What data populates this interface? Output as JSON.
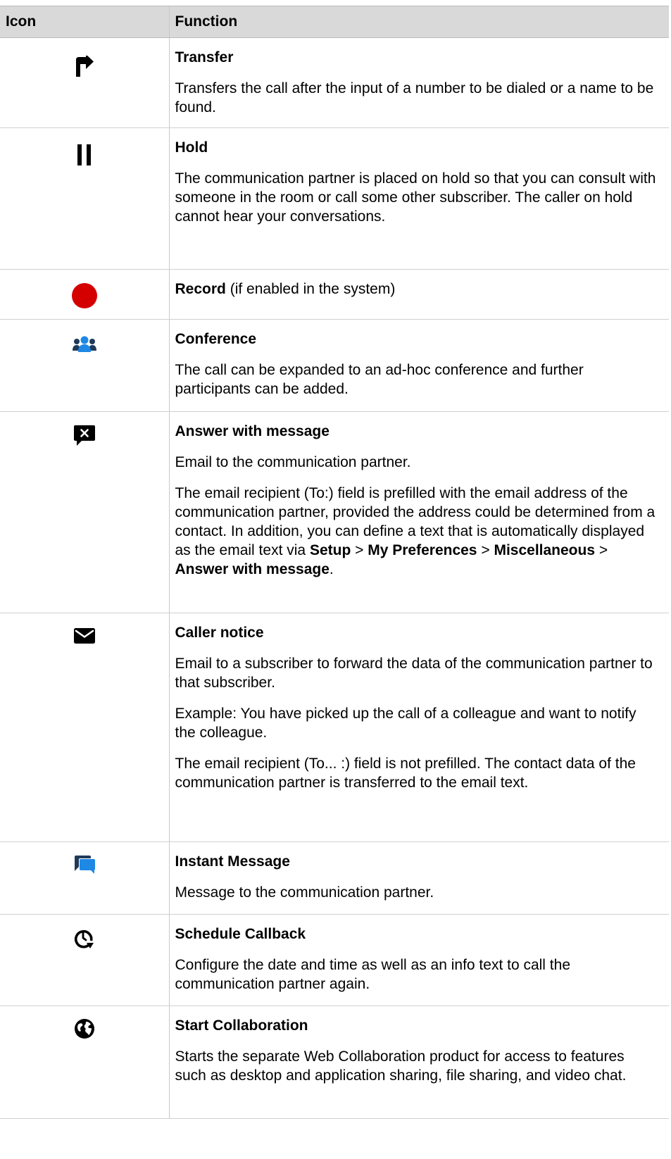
{
  "header": {
    "icon": "Icon",
    "function": "Function"
  },
  "rows": [
    {
      "icon": "transfer-arrow-icon",
      "title": "Transfer",
      "paragraphs": [
        "Transfers the call after the input of a number to be dialed or a name to be found."
      ]
    },
    {
      "icon": "pause-icon",
      "title": "Hold",
      "paragraphs": [
        "The communication partner is placed on hold so that you can consult with someone in the room or call some other subscriber. The caller on hold cannot hear your conversations."
      ]
    },
    {
      "icon": "record-dot-icon",
      "title": "Record",
      "title_note": "(if enabled in the system)",
      "paragraphs": []
    },
    {
      "icon": "conference-people-icon",
      "title": "Conference",
      "paragraphs": [
        "The call can be expanded to an ad-hoc conference and further participants can be added."
      ]
    },
    {
      "icon": "message-reject-icon",
      "title": "Answer with message",
      "paragraphs": [
        "Email to the communication partner.",
        "The email recipient (To:) field is prefilled with the email address of the communication partner, provided the address could be determined from a contact. In addition, you can define a text that is automatically displayed as the email text via"
      ],
      "path": [
        "Setup",
        "My Preferences",
        "Miscellaneous",
        "Answer with message"
      ],
      "path_sep": ">",
      "path_end": "."
    },
    {
      "icon": "envelope-icon",
      "title": "Caller notice",
      "paragraphs": [
        "Email to a subscriber to forward the data of the communication partner to that subscriber.",
        "Example: You have picked up the call of a colleague and want to notify the colleague.",
        "The email recipient (To... :) field is not prefilled. The contact data of the communication partner is transferred to the email text."
      ]
    },
    {
      "icon": "chat-bubbles-icon",
      "title": "Instant Message",
      "paragraphs": [
        "Message to the communication partner."
      ]
    },
    {
      "icon": "clock-callback-icon",
      "title": "Schedule Callback",
      "paragraphs": [
        "Configure the date and time as well as an info text to call the communication partner again."
      ]
    },
    {
      "icon": "globe-collaboration-icon",
      "title": "Start Collaboration",
      "paragraphs": [
        "Starts the separate Web Collaboration product for access to features such as desktop and application sharing, file sharing, and video chat."
      ]
    }
  ],
  "colors": {
    "header_bg": "#d9d9d9",
    "record": "#d40000",
    "accent_blue": "#1e88e5"
  }
}
